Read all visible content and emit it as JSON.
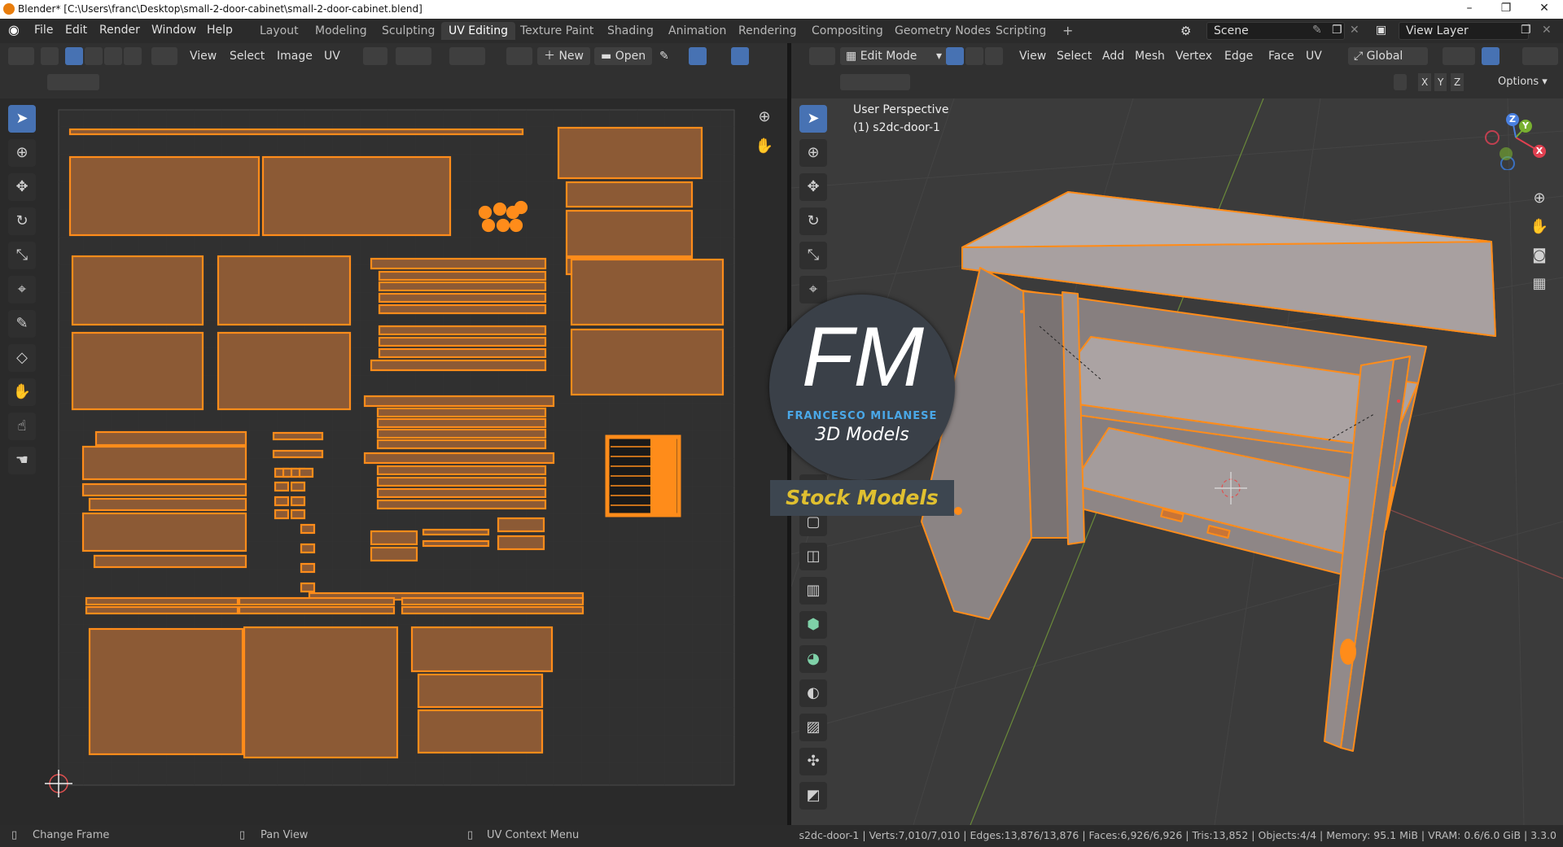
{
  "window": {
    "title": "Blender* [C:\\Users\\franc\\Desktop\\small-2-door-cabinet\\small-2-door-cabinet.blend]",
    "controls": [
      "–",
      "❐",
      "✕"
    ]
  },
  "menu": [
    "File",
    "Edit",
    "Render",
    "Window",
    "Help"
  ],
  "workspaces": {
    "tabs": [
      "Layout",
      "Modeling",
      "Sculpting",
      "UV Editing",
      "Texture Paint",
      "Shading",
      "Animation",
      "Rendering",
      "Compositing",
      "Geometry Nodes",
      "Scripting"
    ],
    "active": "UV Editing",
    "add": "+"
  },
  "scene": {
    "label": "Scene"
  },
  "view_layer": {
    "label": "View Layer"
  },
  "uv_header": {
    "menus": [
      "View",
      "Select",
      "Image",
      "UV"
    ],
    "new_label": "New",
    "open_label": "Open"
  },
  "viewport_header": {
    "mode": "Edit Mode",
    "menus": [
      "View",
      "Select",
      "Add",
      "Mesh",
      "Vertex",
      "Edge",
      "Face",
      "UV"
    ],
    "orientation": "Global",
    "options": "Options",
    "axes": [
      "X",
      "Y",
      "Z"
    ]
  },
  "viewport": {
    "perspective": "User Perspective",
    "object": "(1) s2dc-door-1",
    "gizmo": {
      "x": "X",
      "y": "Y",
      "z": "Z"
    }
  },
  "watermark": {
    "logo": "FM",
    "name": "FRANCESCO MILANESE",
    "subtitle": "3D Models",
    "banner": "Stock Models"
  },
  "status": {
    "left": [
      {
        "icon": "mouse-left-icon",
        "label": "Change Frame"
      },
      {
        "icon": "mouse-middle-icon",
        "label": "Pan View"
      },
      {
        "icon": "mouse-right-icon",
        "label": "UV Context Menu"
      }
    ],
    "stats": "s2dc-door-1 | Verts:7,010/7,010 | Edges:13,876/13,876 | Faces:6,926/6,926 | Tris:13,852 | Objects:4/4 | Memory: 95.1 MiB | VRAM: 0.6/6.0 GiB | 3.3.0"
  },
  "colors": {
    "accent": "#4772b3",
    "uv_fill": "#8c5a35",
    "uv_edge": "#ff8c1a",
    "mesh": "#9e9696"
  }
}
